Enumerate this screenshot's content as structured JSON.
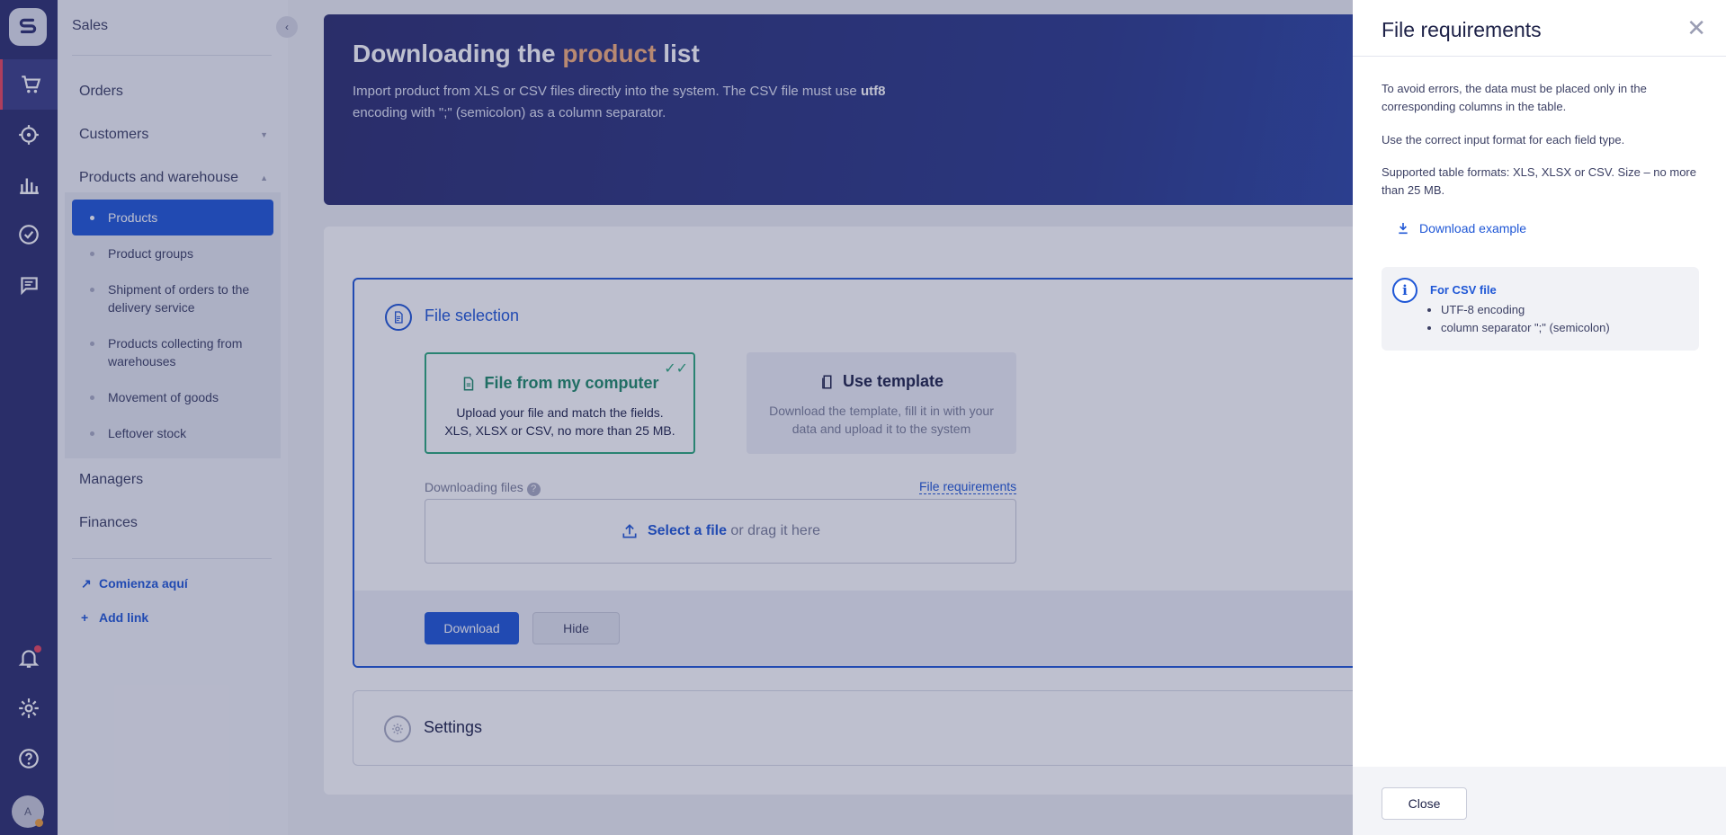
{
  "sidebar": {
    "header": "Sales",
    "items": [
      {
        "label": "Orders"
      },
      {
        "label": "Customers"
      },
      {
        "label": "Products and warehouse"
      },
      {
        "label": "Managers"
      },
      {
        "label": "Finances"
      }
    ],
    "sub_items": [
      {
        "label": "Products"
      },
      {
        "label": "Product groups"
      },
      {
        "label": "Shipment of orders to the delivery service"
      },
      {
        "label": "Products collecting from warehouses"
      },
      {
        "label": "Movement of goods"
      },
      {
        "label": "Leftover stock"
      }
    ],
    "links": [
      {
        "label": "Comienza aquí"
      },
      {
        "label": "Add link"
      }
    ]
  },
  "rail": {
    "icons": [
      "logo-icon",
      "cart-icon",
      "target-icon",
      "chart-icon",
      "check-circle-icon",
      "chat-icon",
      "bell-icon",
      "gear-icon",
      "help-icon"
    ],
    "avatar_letter": "A"
  },
  "hero": {
    "title_pre": "Downloading the ",
    "title_highlight": "product",
    "title_post": " list",
    "desc_pre": "Import product from XLS or CSV files directly into the system. The CSV file must use ",
    "desc_bold": "utf8",
    "desc_post": " encoding with \";\" (semicolon) as a column separator."
  },
  "file_selection": {
    "title": "File selection",
    "option_computer": {
      "title": "File from my computer",
      "desc": "Upload your file and match the fields. XLS, XLSX or CSV, no more than 25 MB."
    },
    "option_template": {
      "title": "Use template",
      "desc": "Download the template, fill it in with your data and upload it to the system"
    },
    "downloading_label": "Downloading files",
    "requirements_link": "File requirements",
    "drop_select": "Select a file",
    "drop_rest": " or drag it here",
    "download_button": "Download",
    "hide_button": "Hide"
  },
  "settings": {
    "title": "Settings"
  },
  "drawer": {
    "title": "File requirements",
    "p1": "To avoid errors, the data must be placed only in the corresponding columns in the table.",
    "p2": "Use the correct input format for each field type.",
    "p3": "Supported table formats: XLS, XLSX or CSV. Size – no more than 25 MB.",
    "example_link": "Download example",
    "csv_title": "For CSV file",
    "csv_items": [
      "UTF-8 encoding",
      "column separator \";\" (semicolon)"
    ],
    "close_button": "Close"
  },
  "colors": {
    "rail": "#2b2e6e",
    "accent": "#1f57d6",
    "success": "#2aa87a",
    "highlight": "#f6b07a"
  }
}
